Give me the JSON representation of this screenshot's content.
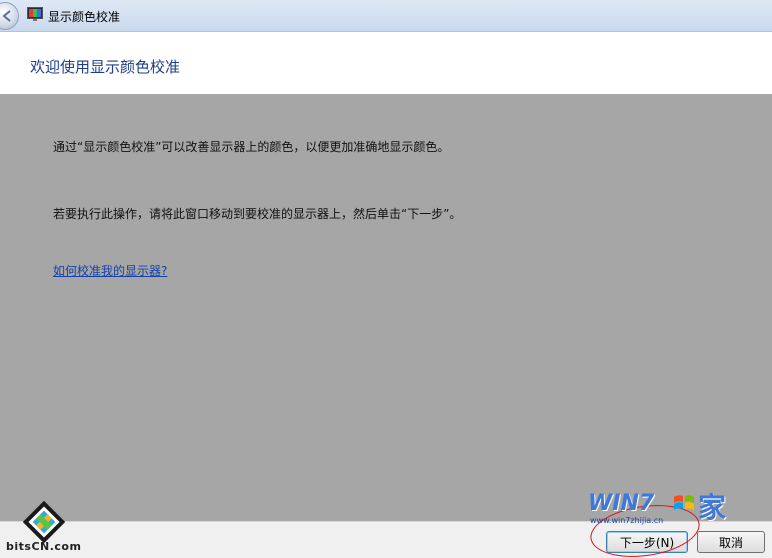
{
  "window": {
    "title": "显示颜色校准",
    "icon": "display-calibration-icon"
  },
  "header": {
    "heading": "欢迎使用显示颜色校准"
  },
  "content": {
    "paragraph_1": "通过“显示颜色校准”可以改善显示器上的颜色，以便更加准确地显示颜色。",
    "paragraph_2": "若要执行此操作，请将此窗口移动到要校准的显示器上，然后单击“下一步”。",
    "help_link": "如何校准我的显示器?"
  },
  "footer": {
    "next_label": "下一步(N)",
    "cancel_label": "取消"
  },
  "watermarks": {
    "left_text": "bitsCN.com",
    "right_brand": "WIN7",
    "right_char": "家",
    "right_url": "www.win7zhijia.cn"
  },
  "colors": {
    "content_background": "#a6a6a6",
    "heading": "#1f3d8a",
    "link": "#1541a8",
    "annotation": "#dd1111"
  }
}
